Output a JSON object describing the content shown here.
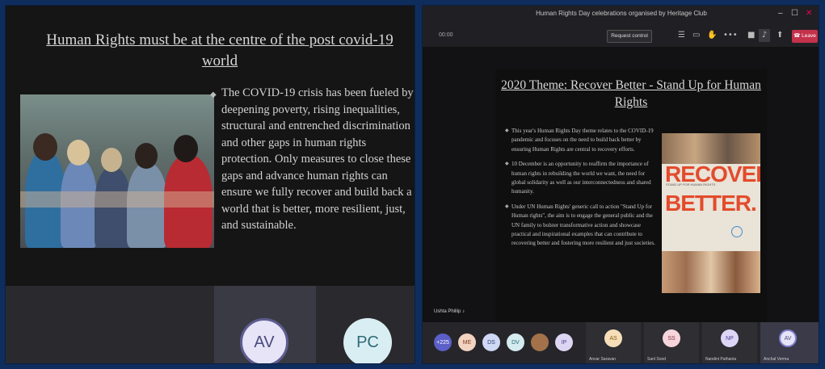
{
  "left_panel": {
    "slide_title": "Human Rights must be at the centre of the post covid-19 world",
    "bullet": "The COVID-19 crisis has been fueled by deepening poverty, rising inequalities, structural and entrenched discrimination and other gaps in human rights protection. Only measures to close these gaps and advance human rights can ensure we fully recover and build back a world that is better, more resilient, just, and sustainable.",
    "participants": [
      {
        "initials": "AV",
        "bg": "#e6e4f6",
        "fg": "#4b4a7e"
      },
      {
        "initials": "PC",
        "bg": "#d9eef3",
        "fg": "#2f6a78"
      }
    ]
  },
  "right_panel": {
    "window_title": "Human Rights Day celebrations organised by Heritage Club",
    "window_controls": {
      "minimize": "–",
      "maximize": "☐",
      "close": "✕"
    },
    "timer": "00:00",
    "request_control_label": "Request control",
    "leave_label": "Leave",
    "slide_title": "2020 Theme: Recover Better - Stand Up for Human Rights",
    "bullets": [
      "This year's Human Rights Day theme relates to the COVID-19 pandemic and focuses on the need to build back better by ensuring Human Rights are central to recovery efforts.",
      "10 December is an opportunity to reaffirm the importance of human rights in rebuilding the world we want, the need for global solidarity as well as our interconnectedness and shared humanity.",
      "Under UN Human Rights' generic call to action \"Stand Up for Human rights\", the aim is to engage the general public and the UN family to bolster transformative action and showcase practical and inspirational examples that can contribute to recovering better and fostering more resilient and just societies."
    ],
    "poster": {
      "line1": "RECOVER",
      "line2": "BETTER.",
      "subtitle": "STAND UP FOR HUMAN RIGHTS"
    },
    "presenter_name": "Ushta Phillip",
    "participant_avatars": [
      {
        "initials": "+225",
        "bg": "#5b5fc7",
        "fg": "#ffffff"
      },
      {
        "initials": "ME",
        "bg": "#f2d3c0",
        "fg": "#7a3f1e"
      },
      {
        "initials": "DS",
        "bg": "#cfd8f4",
        "fg": "#2d3f7a"
      },
      {
        "initials": "DV",
        "bg": "#d4ecef",
        "fg": "#246470"
      },
      {
        "initials": "",
        "bg": "#a3724a",
        "fg": "#ffffff"
      },
      {
        "initials": "IP",
        "bg": "#dcd6f3",
        "fg": "#47408a"
      }
    ],
    "participant_tiles": [
      {
        "initials": "AS",
        "bg": "#f6dfb8",
        "fg": "#8a5a12",
        "name": "Anvar Saravan"
      },
      {
        "initials": "SS",
        "bg": "#f6d6dc",
        "fg": "#8a2c3f",
        "name": "Sanl Sood"
      },
      {
        "initials": "NP",
        "bg": "#ddd6f6",
        "fg": "#4d3f92",
        "name": "Nandini Pathania"
      },
      {
        "initials": "AV",
        "bg": "#e6e4f6",
        "fg": "#4b4a7e",
        "name": "Anchal Verma"
      }
    ]
  }
}
